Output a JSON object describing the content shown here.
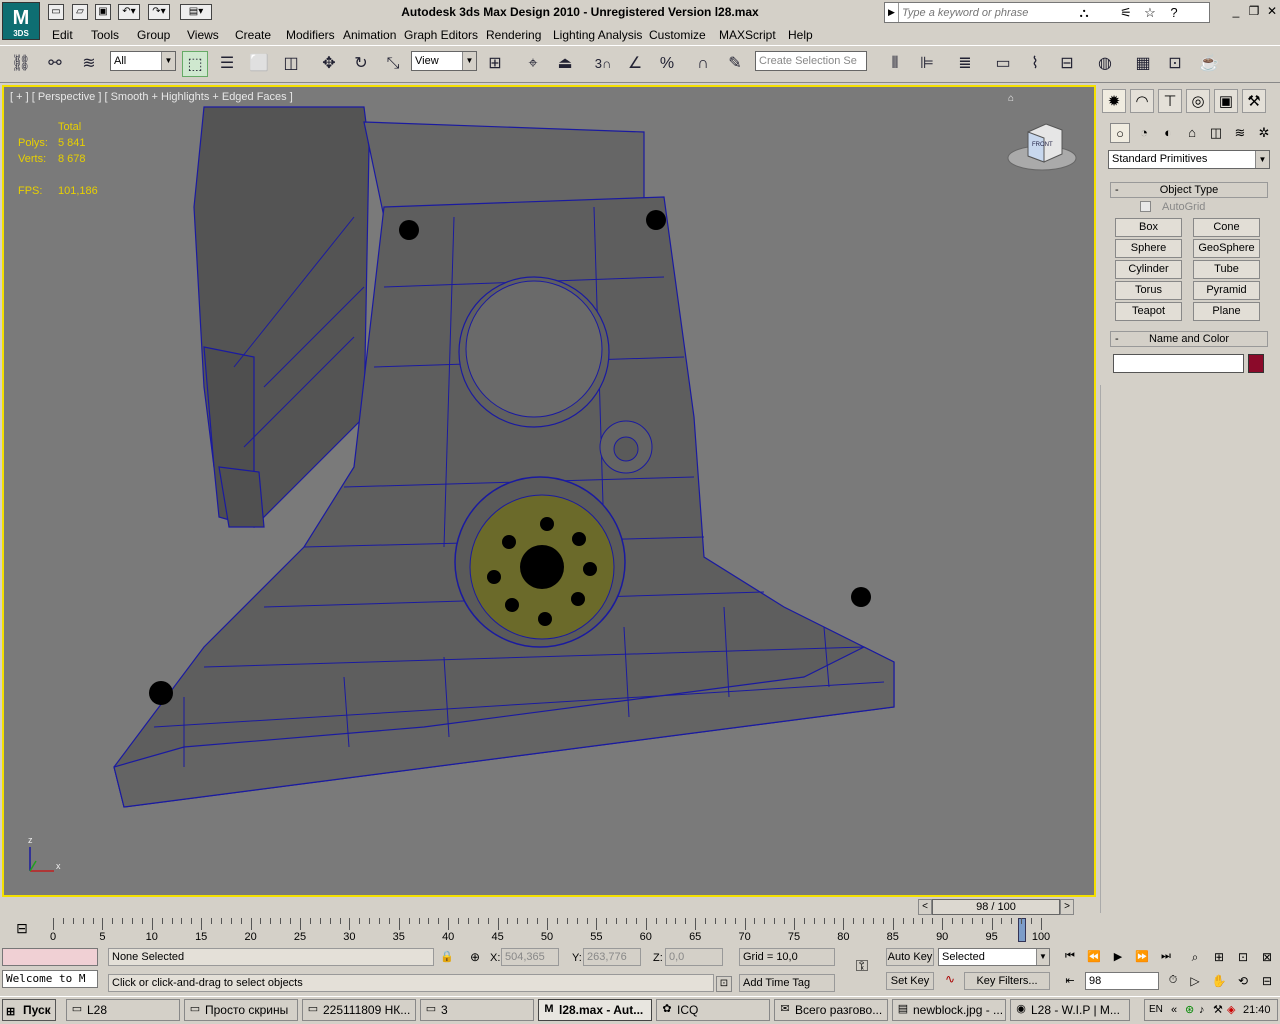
{
  "app": {
    "title": "Autodesk 3ds Max Design 2010  - Unregistered Version    l28.max",
    "logo_text": "M",
    "logo_sub": "3DS"
  },
  "search": {
    "placeholder": "Type a keyword or phrase"
  },
  "menu": [
    "Edit",
    "Tools",
    "Group",
    "Views",
    "Create",
    "Modifiers",
    "Animation",
    "Graph Editors",
    "Rendering",
    "Lighting Analysis",
    "Customize",
    "MAXScript",
    "Help"
  ],
  "toolbar": {
    "filter_value": "All",
    "refcoord_value": "View",
    "selection_set_placeholder": "Create Selection Se",
    "snaps_label": "3"
  },
  "viewport": {
    "label": "[ + ] [ Perspective ] [ Smooth + Highlights + Edged Faces ]",
    "stats_header": "Total",
    "polys_label": "Polys:",
    "polys_value": "5 841",
    "verts_label": "Verts:",
    "verts_value": "8 678",
    "fps_label": "FPS:",
    "fps_value": "101,186",
    "axis_z": "z",
    "axis_x": "x",
    "viewcube_face": "FRONT"
  },
  "command_panel": {
    "category_value": "Standard Primitives",
    "object_type_title": "Object Type",
    "autogrid_label": "AutoGrid",
    "buttons": [
      "Box",
      "Cone",
      "Sphere",
      "GeoSphere",
      "Cylinder",
      "Tube",
      "Torus",
      "Pyramid",
      "Teapot",
      "Plane"
    ],
    "name_color_title": "Name and Color",
    "object_name": "",
    "object_color": "#8b0a2a"
  },
  "timeslider": {
    "frame_display": "98 / 100",
    "frame_current": 98,
    "frame_total": 100,
    "prev_arrow": "<",
    "next_arrow": ">",
    "tick_labels": [
      "0",
      "5",
      "10",
      "15",
      "20",
      "25",
      "30",
      "35",
      "40",
      "45",
      "50",
      "55",
      "60",
      "65",
      "70",
      "75",
      "80",
      "85",
      "90",
      "95",
      "100"
    ]
  },
  "status": {
    "maxscript_listener": "Welcome to M",
    "selection_status": "None Selected",
    "prompt": "Click or click-and-drag to select objects",
    "x_label": "X:",
    "x_value": "504,365",
    "y_label": "Y:",
    "y_value": "263,776",
    "z_label": "Z:",
    "z_value": "0,0",
    "grid_label": "Grid = 10,0",
    "add_time_tag": "Add Time Tag",
    "auto_key": "Auto Key",
    "set_key": "Set Key",
    "key_mode_value": "Selected",
    "key_filters": "Key Filters...",
    "current_frame": "98"
  },
  "taskbar": {
    "start_label": "Пуск",
    "tasks": [
      "L28",
      "Просто скрины",
      "225111809 НК...",
      "3",
      "l28.max - Aut...",
      "ICQ",
      "Всего разгово...",
      "newblock.jpg - ...",
      "L28 - W.I.P | M..."
    ],
    "active_index": 4,
    "lang": "EN",
    "clock": "21:40"
  },
  "colors": {
    "viewport_bg": "#7a7a7a",
    "viewport_border": "#f4e000",
    "wire": "#1a1aa0",
    "stats": "#e8d000"
  }
}
